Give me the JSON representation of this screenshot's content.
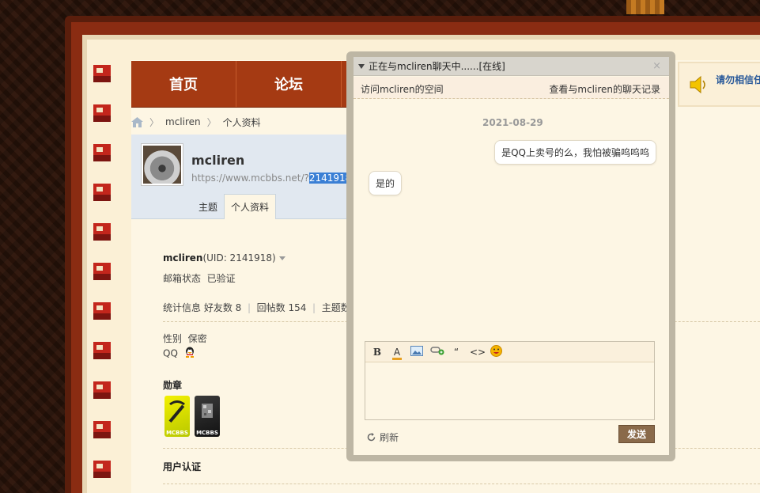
{
  "nav": {
    "items": [
      "首页",
      "论坛"
    ]
  },
  "breadcrumb": {
    "user": "mcliren",
    "page": "个人资料"
  },
  "profile": {
    "username": "mcliren",
    "url_prefix": "https://www.mcbbs.net/?",
    "url_uid": "2141918",
    "tabs": [
      "主题",
      "个人资料"
    ]
  },
  "details": {
    "name_line": "mcliren",
    "uid_text": "(UID: 2141918)",
    "email_label": "邮箱状态",
    "email_value": "已验证",
    "stats_label": "统计信息",
    "friends": "好友数 8",
    "replies": "回帖数 154",
    "threads": "主题数",
    "gender_label": "性别",
    "gender_value": "保密",
    "qq_label": "QQ",
    "medals_label": "勋章",
    "medal_text": "MCBBS",
    "auth_label": "用户认证"
  },
  "notice": {
    "text": "请勿相信任"
  },
  "chat": {
    "title": "正在与mcliren聊天中......[在线]",
    "close": "×",
    "visit_link": "访问mcliren的空间",
    "history_link": "查看与mcliren的聊天记录",
    "date": "2021-08-29",
    "messages": [
      {
        "side": "right",
        "text": "是QQ上卖号的么，我怕被骗呜呜呜"
      },
      {
        "side": "left",
        "text": "是的"
      }
    ],
    "toolbar": {
      "bold": "B",
      "color": "A",
      "quote": "“",
      "code": "<>"
    },
    "refresh_label": "刷新",
    "send_label": "发送"
  },
  "colors": {
    "nav_bg": "#a53a13",
    "link_blue": "#2a5a9a",
    "send_bg": "#8a6a4a"
  }
}
